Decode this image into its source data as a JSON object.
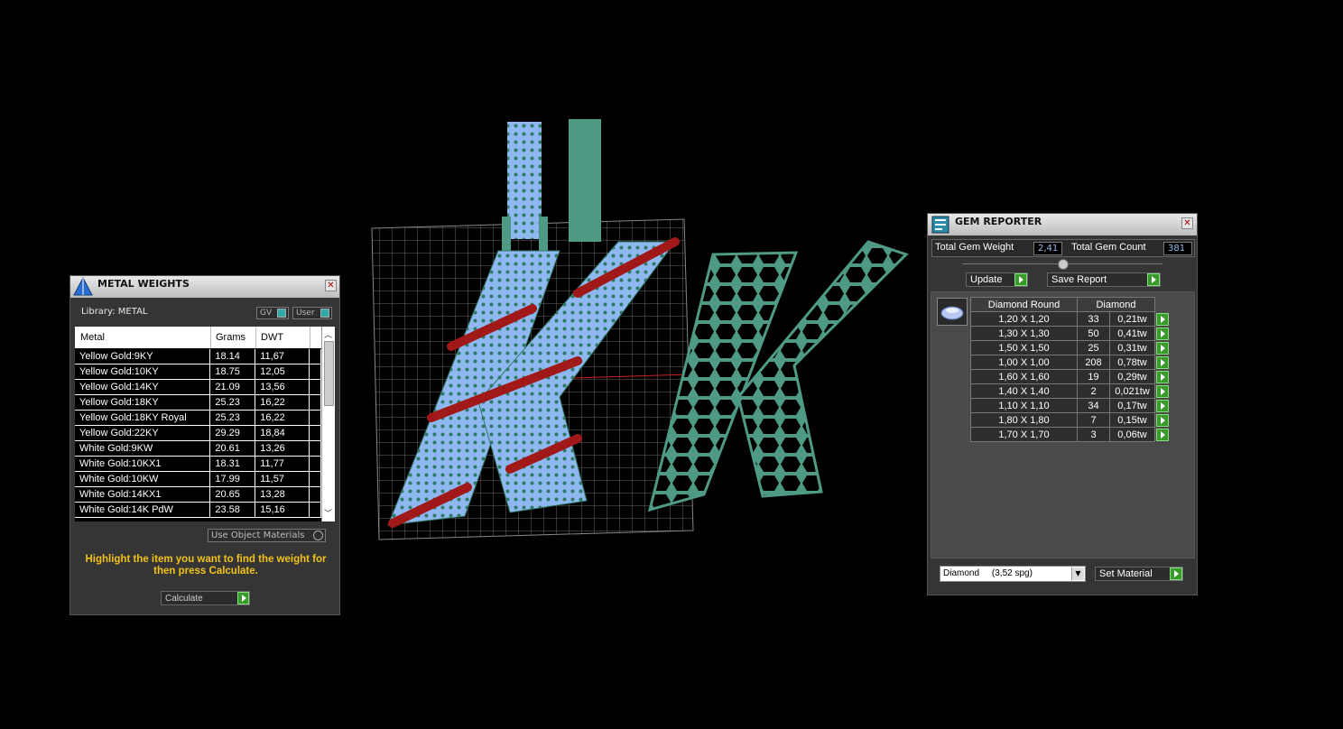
{
  "metal": {
    "title": "METAL WEIGHTS",
    "library_label": "Library: METAL",
    "gv_label": "GV",
    "user_label": "User",
    "headers": [
      "Metal",
      "Grams",
      "DWT"
    ],
    "rows": [
      [
        "Yellow Gold:9KY",
        "18.14",
        "11,67"
      ],
      [
        "Yellow Gold:10KY",
        "18.75",
        "12,05"
      ],
      [
        "Yellow Gold:14KY",
        "21.09",
        "13,56"
      ],
      [
        "Yellow Gold:18KY",
        "25.23",
        "16,22"
      ],
      [
        "Yellow Gold:18KY Royal",
        "25.23",
        "16,22"
      ],
      [
        "Yellow Gold:22KY",
        "29.29",
        "18,84"
      ],
      [
        "White Gold:9KW",
        "20.61",
        "13,26"
      ],
      [
        "White Gold:10KX1",
        "18.31",
        "11,77"
      ],
      [
        "White Gold:10KW",
        "17.99",
        "11,57"
      ],
      [
        "White Gold:14KX1",
        "20.65",
        "13,28"
      ],
      [
        "White Gold:14K PdW",
        "23.58",
        "15,16"
      ]
    ],
    "use_object_label": "Use Object Materials",
    "hint": "Highlight the item you want to find the weight for then press Calculate.",
    "calculate_label": "Calculate",
    "hint_color": "#f2c21b"
  },
  "gem": {
    "title": "GEM REPORTER",
    "total_weight_label": "Total Gem Weight",
    "total_weight_value": "2,41",
    "total_count_label": "Total Gem Count",
    "total_count_value": "381",
    "update_label": "Update",
    "save_label": "Save Report",
    "header_cut": "Diamond Round",
    "header_mat": "Diamond",
    "rows": [
      [
        "1,20 X 1,20",
        "33",
        "0,21tw"
      ],
      [
        "1,30 X 1,30",
        "50",
        "0,41tw"
      ],
      [
        "1,50 X 1,50",
        "25",
        "0,31tw"
      ],
      [
        "1,00 X 1,00",
        "208",
        "0,78tw"
      ],
      [
        "1,60 X 1,60",
        "19",
        "0,29tw"
      ],
      [
        "1,40 X 1,40",
        "2",
        "0,021tw"
      ],
      [
        "1,10 X 1,10",
        "34",
        "0,17tw"
      ],
      [
        "1,80 X 1,80",
        "7",
        "0,15tw"
      ],
      [
        "1,70 X 1,70",
        "3",
        "0,06tw"
      ]
    ],
    "material_select": "Diamond     (3,52 spg)",
    "set_material_label": "Set Material"
  },
  "colors": {
    "accent_green": "#3a9a2a",
    "model_blue": "#8fb8f0",
    "model_teal": "#4f9a85",
    "gem_red": "#a01818"
  }
}
